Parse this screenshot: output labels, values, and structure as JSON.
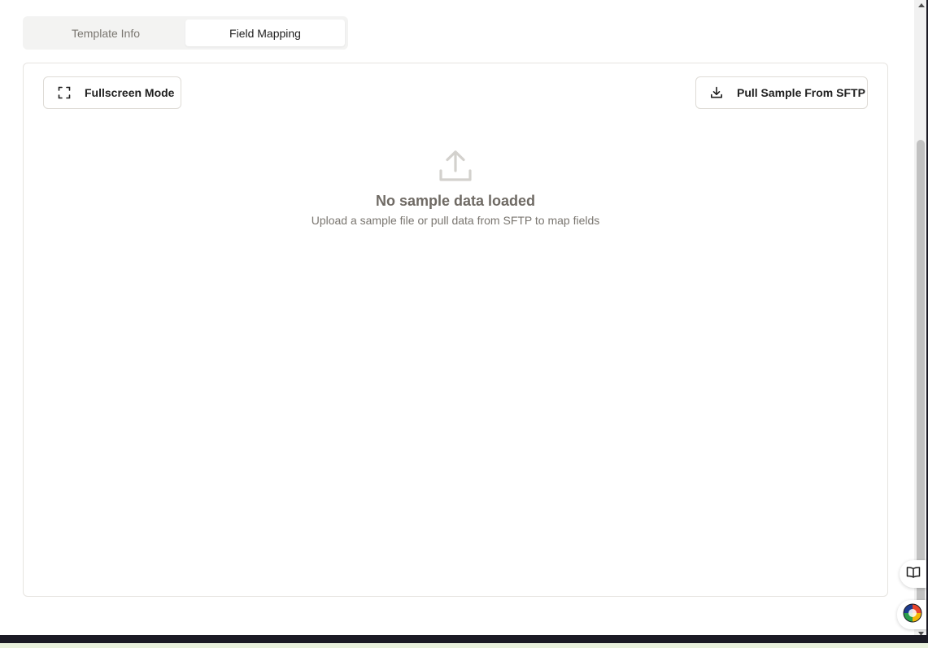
{
  "tabs": [
    {
      "label": "Template Info",
      "active": false
    },
    {
      "label": "Field Mapping",
      "active": true
    }
  ],
  "toolbar": {
    "fullscreen_label": "Fullscreen Mode",
    "fullscreen_icon": "expand-corners-icon",
    "pull_sample_label": "Pull Sample From SFTP",
    "pull_sample_icon": "download-icon"
  },
  "empty_state": {
    "icon": "upload-icon",
    "title": "No sample data loaded",
    "subtitle": "Upload a sample file or pull data from SFTP to map fields"
  },
  "floating": {
    "book_icon": "book-open-icon",
    "globe_icon": "color-globe-icon"
  },
  "colors": {
    "tab_bg": "#f3f3f2",
    "border": "#e6e4e0",
    "muted_text": "#7a7670",
    "empty_title": "#6f6a64",
    "icon_gray": "#d3d1cd"
  }
}
